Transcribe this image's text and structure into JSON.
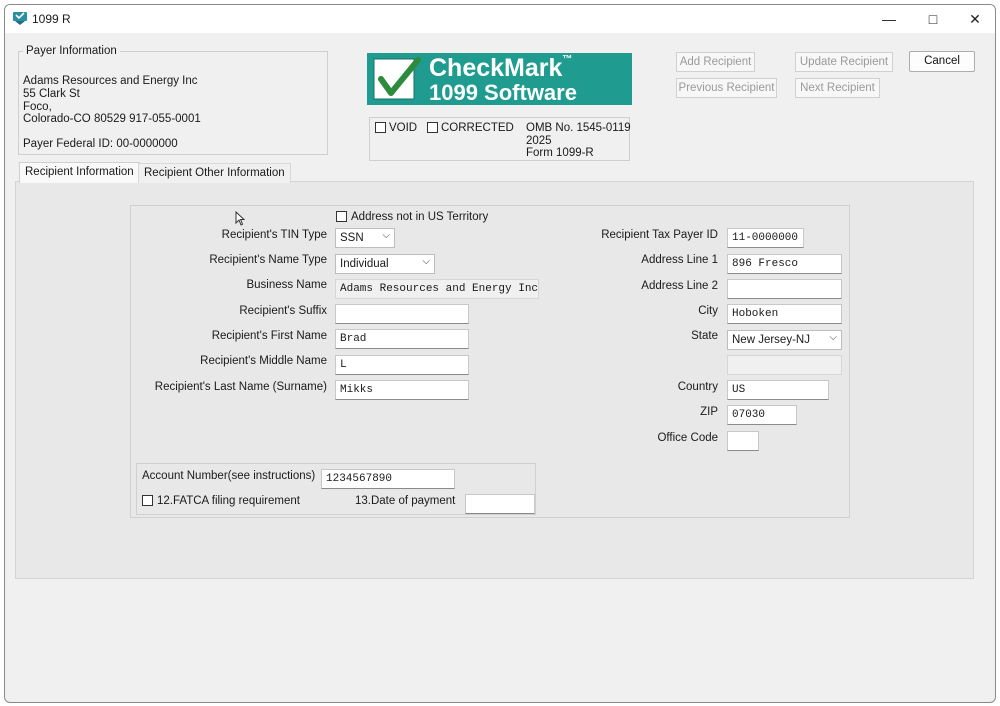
{
  "window": {
    "title": "1099 R"
  },
  "titlebar": {
    "minimize_icon": "minimize-icon",
    "maximize_icon": "maximize-icon",
    "close_icon": "close-icon"
  },
  "payer": {
    "legend": "Payer Information",
    "name": "Adams Resources and Energy Inc",
    "address1": "55 Clark St",
    "address2": "Foco,",
    "city_line": "Colorado-CO  80529  917-055-0001",
    "federal_id": "Payer Federal ID: 00-0000000"
  },
  "logo": {
    "line1": "CheckMark",
    "tm": "™",
    "line2": "1099 Software",
    "bg_color": "#1f9c8f"
  },
  "form_info": {
    "void_label": "VOID",
    "corrected_label": "CORRECTED",
    "omb": "OMB No. 1545-0119",
    "year": "2025",
    "form": "Form 1099-R"
  },
  "actions": {
    "add_recipient": "Add Recipient",
    "update_recipient": "Update Recipient",
    "cancel": "Cancel",
    "previous_recipient": "Previous Recipient",
    "next_recipient": "Next Recipient"
  },
  "tabs": [
    {
      "label": "Recipient Information",
      "selected": true
    },
    {
      "label": "Recipient Other Information",
      "selected": false
    }
  ],
  "recipient": {
    "address_not_us_label": "Address not in US Territory",
    "tin_type_label": "Recipient's TIN Type",
    "tin_type_value": "SSN",
    "name_type_label": "Recipient's Name Type",
    "name_type_value": "Individual",
    "business_name_label": "Business Name",
    "business_name_value": "Adams Resources and Energy Inc",
    "suffix_label": "Recipient's Suffix",
    "suffix_value": "",
    "first_name_label": "Recipient's First Name",
    "first_name_value": "Brad",
    "middle_name_label": "Recipient's Middle Name",
    "middle_name_value": "L",
    "last_name_label": "Recipient's Last Name (Surname)",
    "last_name_value": "Mikks",
    "tax_id_label": "Recipient Tax Payer ID",
    "tax_id_value": "11-0000000",
    "address1_label": "Address Line 1",
    "address1_value": "896 Fresco",
    "address2_label": "Address Line 2",
    "address2_value": "",
    "city_label": "City",
    "city_value": "Hoboken",
    "state_label": "State",
    "state_value": "New Jersey-NJ",
    "country_label": "Country",
    "country_value": "US",
    "zip_label": "ZIP",
    "zip_value": "07030",
    "office_code_label": "Office Code",
    "office_code_value": ""
  },
  "account": {
    "account_number_label": "Account Number(see instructions)",
    "account_number_value": "1234567890",
    "fatca_label": "12.FATCA filing requirement",
    "date_of_payment_label": "13.Date of payment",
    "date_of_payment_value": ""
  }
}
